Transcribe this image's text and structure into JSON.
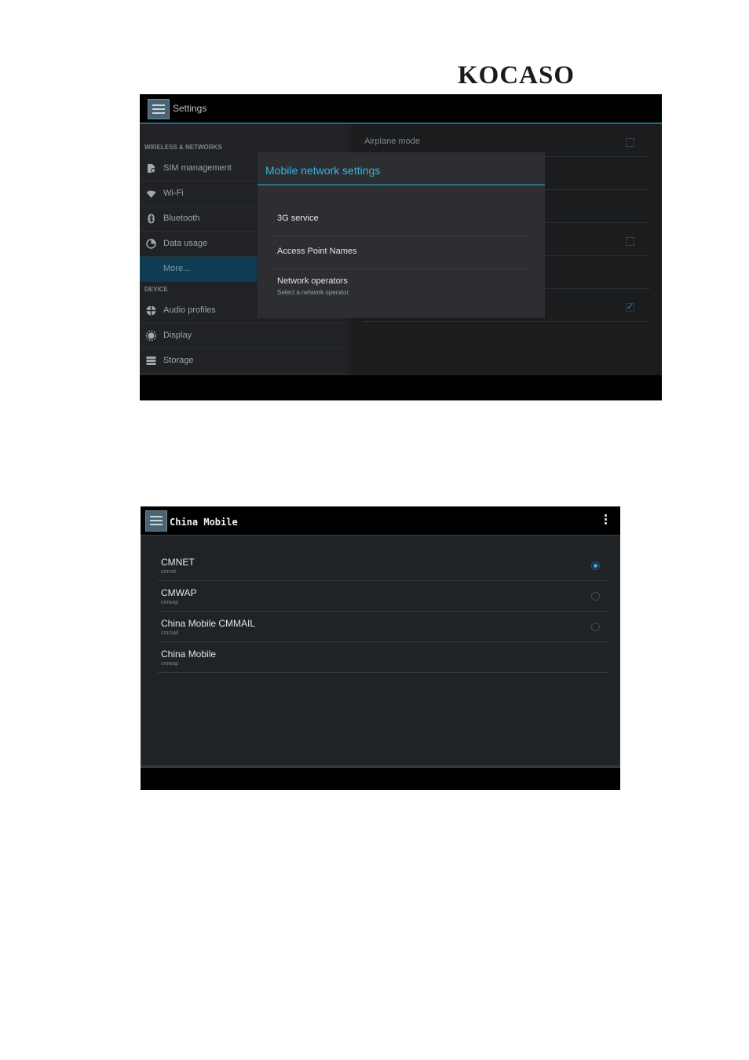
{
  "logo": {
    "text": "KOCASO"
  },
  "screen1": {
    "action_bar": {
      "title": "Settings"
    },
    "sidebar": {
      "section_wireless": "WIRELESS & NETWORKS",
      "section_device": "DEVICE",
      "items": [
        {
          "label": "SIM management",
          "icon": "sim-icon"
        },
        {
          "label": "Wi-Fi",
          "icon": "wifi-icon"
        },
        {
          "label": "Bluetooth",
          "icon": "bluetooth-icon"
        },
        {
          "label": "Data usage",
          "icon": "data-usage-icon"
        },
        {
          "label": "More...",
          "icon": "",
          "selected": true
        },
        {
          "label": "Audio profiles",
          "icon": "audio-profiles-icon"
        },
        {
          "label": "Display",
          "icon": "display-icon"
        },
        {
          "label": "Storage",
          "icon": "storage-icon"
        }
      ]
    },
    "main": {
      "rows": [
        {
          "label": "Airplane mode",
          "checkbox": "unchecked"
        },
        {
          "label": "",
          "checkbox": "none"
        },
        {
          "label": "",
          "checkbox": "none"
        },
        {
          "label": "",
          "checkbox": "unchecked"
        },
        {
          "label": "",
          "checkbox": "none"
        },
        {
          "label": "",
          "checkbox": "checked"
        }
      ]
    },
    "dialog": {
      "title": "Mobile network settings",
      "options": [
        {
          "title": "3G service",
          "summary": ""
        },
        {
          "title": "Access Point Names",
          "summary": ""
        },
        {
          "title": "Network operators",
          "summary": "Select a network operator"
        }
      ]
    }
  },
  "screen2": {
    "action_bar": {
      "title": "China Mobile"
    },
    "apns": [
      {
        "name": "CMNET",
        "apn": "cmnet",
        "selected": true
      },
      {
        "name": "CMWAP",
        "apn": "cmwap",
        "selected": false
      },
      {
        "name": "China Mobile CMMAIL",
        "apn": "cmmail",
        "selected": false
      },
      {
        "name": "China Mobile",
        "apn": "cmwap",
        "selected": false
      }
    ]
  },
  "colors": {
    "accent": "#33b5e5",
    "selected_bg": "#0f3e54",
    "background": "#1d1f21"
  }
}
